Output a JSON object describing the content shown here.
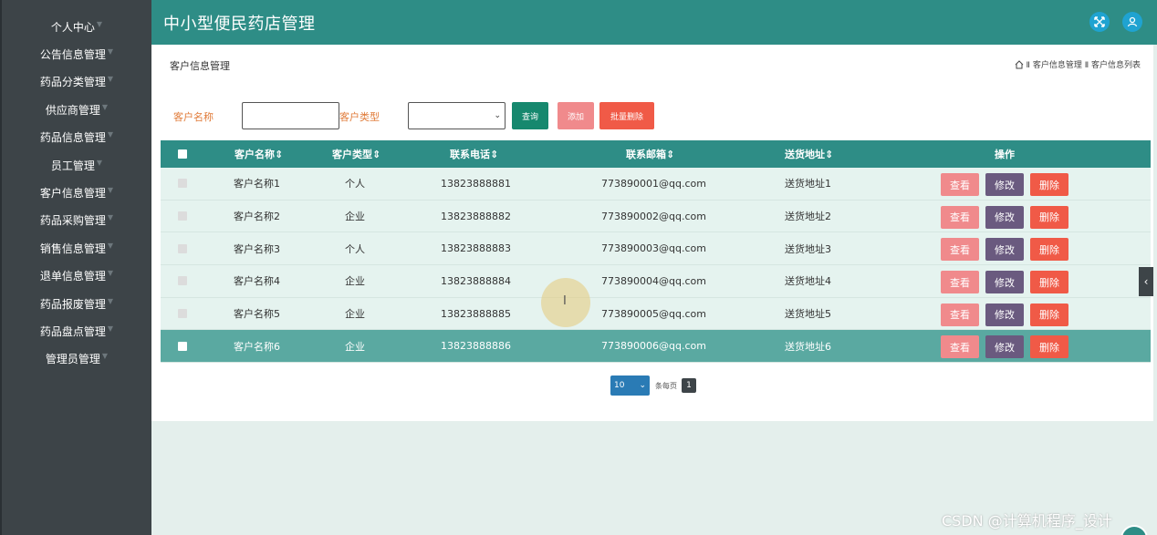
{
  "app": {
    "title": "中小型便民药店管理"
  },
  "sidebar": {
    "items": [
      {
        "label": "个人中心"
      },
      {
        "label": "公告信息管理"
      },
      {
        "label": "药品分类管理"
      },
      {
        "label": "供应商管理"
      },
      {
        "label": "药品信息管理"
      },
      {
        "label": "员工管理"
      },
      {
        "label": "客户信息管理"
      },
      {
        "label": "药品采购管理"
      },
      {
        "label": "销售信息管理"
      },
      {
        "label": "退单信息管理"
      },
      {
        "label": "药品报废管理"
      },
      {
        "label": "药品盘点管理"
      },
      {
        "label": "管理员管理"
      }
    ]
  },
  "page": {
    "title": "客户信息管理",
    "breadcrumb": "Ⅱ 客户信息管理 Ⅱ 客户信息列表"
  },
  "search": {
    "name_label": "客户名称",
    "type_label": "客户类型",
    "query_label": "查询",
    "add_label": "添加",
    "batch_delete_label": "批量删除"
  },
  "table": {
    "headers": {
      "name": "客户名称",
      "type": "客户类型",
      "phone": "联系电话",
      "email": "联系邮箱",
      "address": "送货地址",
      "actions": "操作"
    },
    "rows": [
      {
        "name": "客户名称1",
        "type": "个人",
        "phone": "13823888881",
        "email": "773890001@qq.com",
        "address": "送货地址1"
      },
      {
        "name": "客户名称2",
        "type": "企业",
        "phone": "13823888882",
        "email": "773890002@qq.com",
        "address": "送货地址2"
      },
      {
        "name": "客户名称3",
        "type": "个人",
        "phone": "13823888883",
        "email": "773890003@qq.com",
        "address": "送货地址3"
      },
      {
        "name": "客户名称4",
        "type": "企业",
        "phone": "13823888884",
        "email": "773890004@qq.com",
        "address": "送货地址4"
      },
      {
        "name": "客户名称5",
        "type": "企业",
        "phone": "13823888885",
        "email": "773890005@qq.com",
        "address": "送货地址5"
      },
      {
        "name": "客户名称6",
        "type": "企业",
        "phone": "13823888886",
        "email": "773890006@qq.com",
        "address": "送货地址6"
      }
    ],
    "actions": {
      "view": "查看",
      "edit": "修改",
      "delete": "删除"
    },
    "selected_row": 6
  },
  "pagination": {
    "page_size": "10",
    "per_page_label": "条每页",
    "current_page": "1"
  },
  "watermark": "CSDN @计算机程序_设计",
  "colors": {
    "header": "#2e8d86",
    "sidebar": "#3d4448",
    "accent_orange": "#e07b39"
  }
}
